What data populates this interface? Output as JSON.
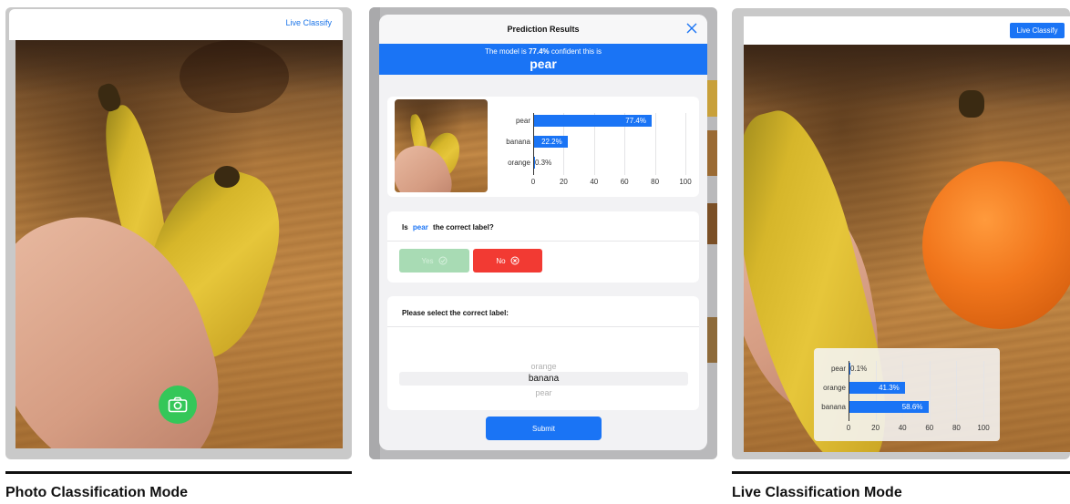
{
  "left": {
    "topbar_link": "Live Classify",
    "camera_button_icon": "camera-icon"
  },
  "middle": {
    "title": "Prediction Results",
    "banner": {
      "prefix": "The model is",
      "confidence": "77.4%",
      "suffix": "confident this is",
      "label": "pear"
    },
    "chart_data": {
      "type": "bar",
      "orientation": "horizontal",
      "categories": [
        "pear",
        "banana",
        "orange"
      ],
      "values": [
        77.4,
        22.2,
        0.3
      ],
      "value_labels": [
        "77.4%",
        "22.2%",
        "0.3%"
      ],
      "xlim": [
        0,
        100
      ],
      "xticks": [
        "0",
        "20",
        "40",
        "60",
        "80",
        "100"
      ],
      "grid": true,
      "color": "#1a74f5"
    },
    "question": {
      "prefix": "Is",
      "label": "pear",
      "suffix": "the correct label?"
    },
    "yes_label": "Yes",
    "no_label": "No",
    "select_prompt": "Please select the correct label:",
    "picker_options": [
      "orange",
      "banana",
      "pear"
    ],
    "picker_selected": "banana",
    "submit_label": "Submit"
  },
  "right": {
    "live_button": "Live Classify",
    "chart_data": {
      "type": "bar",
      "orientation": "horizontal",
      "categories": [
        "pear",
        "orange",
        "banana"
      ],
      "values": [
        0.1,
        41.3,
        58.6
      ],
      "value_labels": [
        "0.1%",
        "41.3%",
        "58.6%"
      ],
      "xlim": [
        0,
        100
      ],
      "xticks": [
        "0",
        "20",
        "40",
        "60",
        "80",
        "100"
      ],
      "grid": true,
      "color": "#1a74f5"
    }
  },
  "captions": {
    "left": "Photo Classification Mode",
    "right": "Live Classification Mode"
  },
  "colors": {
    "accent": "#1a74f5",
    "yes_disabled": "#a8dbb4",
    "no": "#f23a33",
    "camera": "#34c759"
  }
}
